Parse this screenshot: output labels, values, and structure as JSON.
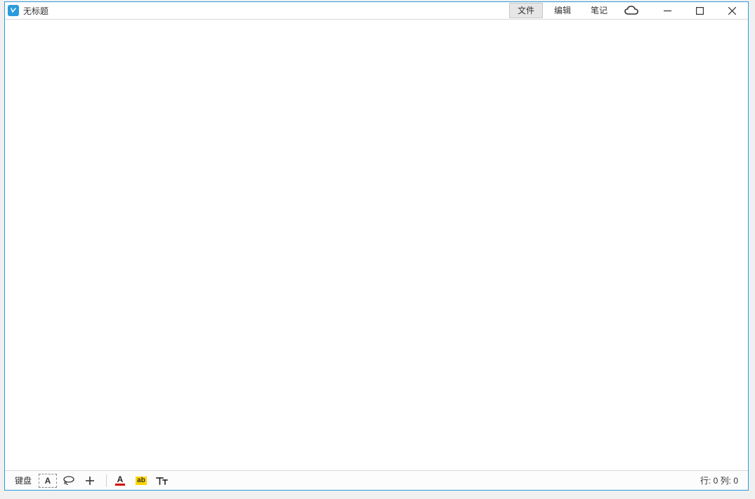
{
  "window": {
    "title": "无标题"
  },
  "menu": {
    "file": "文件",
    "edit": "编辑",
    "notes": "笔记"
  },
  "toolbar": {
    "keyboard": "键盘",
    "select_letter": "A",
    "font_color_letter": "A",
    "highlight_label": "ab"
  },
  "status": {
    "text": "行: 0 列: 0"
  }
}
